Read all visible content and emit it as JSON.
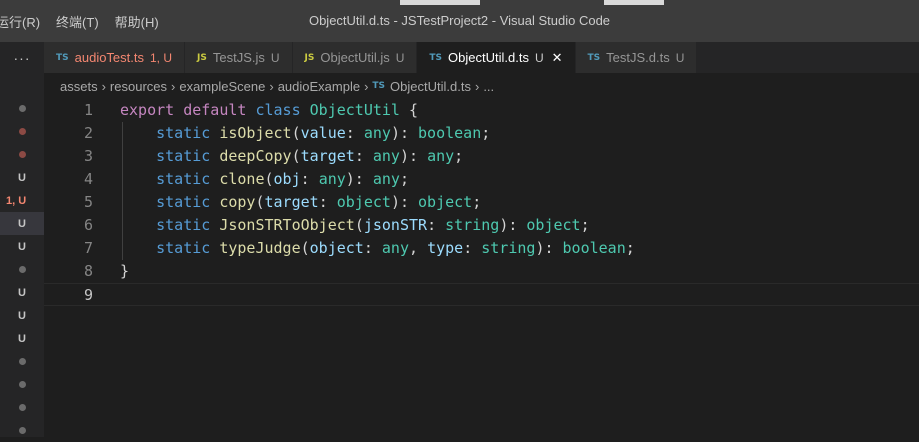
{
  "titlebar": {
    "menu": [
      "运行(R)",
      "终端(T)",
      "帮助(H)"
    ],
    "window_title": "ObjectUtil.d.ts - JSTestProject2 - Visual Studio Code"
  },
  "tabbar": {
    "more_icon": "more-icon",
    "tabs": [
      {
        "type": "TS",
        "name": "audioTest.ts",
        "status": "1, U",
        "state": "error"
      },
      {
        "type": "JS",
        "name": "TestJS.js",
        "status": "U",
        "state": "normal"
      },
      {
        "type": "JS",
        "name": "ObjectUtil.js",
        "status": "U",
        "state": "normal"
      },
      {
        "type": "TS",
        "name": "ObjectUtil.d.ts",
        "status": "U",
        "state": "active",
        "close_icon": "close-icon"
      },
      {
        "type": "TS",
        "name": "TestJS.d.ts",
        "status": "U",
        "state": "normal"
      }
    ]
  },
  "breadcrumb": {
    "items": [
      "assets",
      "resources",
      "exampleScene",
      "audioExample"
    ],
    "file_type": "TS",
    "file": "ObjectUtil.d.ts",
    "trail": "..."
  },
  "left_strip": {
    "rows": [
      {
        "kind": "dot",
        "label": ""
      },
      {
        "kind": "dot-red",
        "label": ""
      },
      {
        "kind": "dot-red",
        "label": ""
      },
      {
        "kind": "text",
        "label": "U"
      },
      {
        "kind": "err",
        "label": "1, U"
      },
      {
        "kind": "sel",
        "label": "U"
      },
      {
        "kind": "text",
        "label": "U"
      },
      {
        "kind": "dot",
        "label": ""
      },
      {
        "kind": "text",
        "label": "U"
      },
      {
        "kind": "text",
        "label": "U"
      },
      {
        "kind": "text",
        "label": "U"
      },
      {
        "kind": "dot",
        "label": ""
      },
      {
        "kind": "dot",
        "label": ""
      },
      {
        "kind": "dot",
        "label": ""
      },
      {
        "kind": "dot",
        "label": ""
      }
    ]
  },
  "editor": {
    "current_line": 9,
    "lines": [
      {
        "num": "1",
        "tokens": [
          [
            "kw2",
            "export"
          ],
          [
            "punc",
            " "
          ],
          [
            "kw2",
            "default"
          ],
          [
            "punc",
            " "
          ],
          [
            "kw",
            "class"
          ],
          [
            "punc",
            " "
          ],
          [
            "cls",
            "ObjectUtil"
          ],
          [
            "punc",
            " {"
          ]
        ]
      },
      {
        "num": "2",
        "tokens": [
          [
            "punc",
            "    "
          ],
          [
            "kw",
            "static"
          ],
          [
            "punc",
            " "
          ],
          [
            "fn",
            "isObject"
          ],
          [
            "punc",
            "("
          ],
          [
            "param",
            "value"
          ],
          [
            "punc",
            ": "
          ],
          [
            "type",
            "any"
          ],
          [
            "punc",
            "): "
          ],
          [
            "type",
            "boolean"
          ],
          [
            "punc",
            ";"
          ]
        ]
      },
      {
        "num": "3",
        "tokens": [
          [
            "punc",
            "    "
          ],
          [
            "kw",
            "static"
          ],
          [
            "punc",
            " "
          ],
          [
            "fn",
            "deepCopy"
          ],
          [
            "punc",
            "("
          ],
          [
            "param",
            "target"
          ],
          [
            "punc",
            ": "
          ],
          [
            "type",
            "any"
          ],
          [
            "punc",
            "): "
          ],
          [
            "type",
            "any"
          ],
          [
            "punc",
            ";"
          ]
        ]
      },
      {
        "num": "4",
        "tokens": [
          [
            "punc",
            "    "
          ],
          [
            "kw",
            "static"
          ],
          [
            "punc",
            " "
          ],
          [
            "fn",
            "clone"
          ],
          [
            "punc",
            "("
          ],
          [
            "param",
            "obj"
          ],
          [
            "punc",
            ": "
          ],
          [
            "type",
            "any"
          ],
          [
            "punc",
            "): "
          ],
          [
            "type",
            "any"
          ],
          [
            "punc",
            ";"
          ]
        ]
      },
      {
        "num": "5",
        "tokens": [
          [
            "punc",
            "    "
          ],
          [
            "kw",
            "static"
          ],
          [
            "punc",
            " "
          ],
          [
            "fn",
            "copy"
          ],
          [
            "punc",
            "("
          ],
          [
            "param",
            "target"
          ],
          [
            "punc",
            ": "
          ],
          [
            "type",
            "object"
          ],
          [
            "punc",
            "): "
          ],
          [
            "type",
            "object"
          ],
          [
            "punc",
            ";"
          ]
        ]
      },
      {
        "num": "6",
        "tokens": [
          [
            "punc",
            "    "
          ],
          [
            "kw",
            "static"
          ],
          [
            "punc",
            " "
          ],
          [
            "fn",
            "JsonSTRToObject"
          ],
          [
            "punc",
            "("
          ],
          [
            "param",
            "jsonSTR"
          ],
          [
            "punc",
            ": "
          ],
          [
            "type",
            "string"
          ],
          [
            "punc",
            "): "
          ],
          [
            "type",
            "object"
          ],
          [
            "punc",
            ";"
          ]
        ]
      },
      {
        "num": "7",
        "tokens": [
          [
            "punc",
            "    "
          ],
          [
            "kw",
            "static"
          ],
          [
            "punc",
            " "
          ],
          [
            "fn",
            "typeJudge"
          ],
          [
            "punc",
            "("
          ],
          [
            "param",
            "object"
          ],
          [
            "punc",
            ": "
          ],
          [
            "type",
            "any"
          ],
          [
            "punc",
            ", "
          ],
          [
            "param",
            "type"
          ],
          [
            "punc",
            ": "
          ],
          [
            "type",
            "string"
          ],
          [
            "punc",
            "): "
          ],
          [
            "type",
            "boolean"
          ],
          [
            "punc",
            ";"
          ]
        ]
      },
      {
        "num": "8",
        "tokens": [
          [
            "punc",
            "}"
          ]
        ]
      },
      {
        "num": "9",
        "tokens": []
      }
    ]
  }
}
